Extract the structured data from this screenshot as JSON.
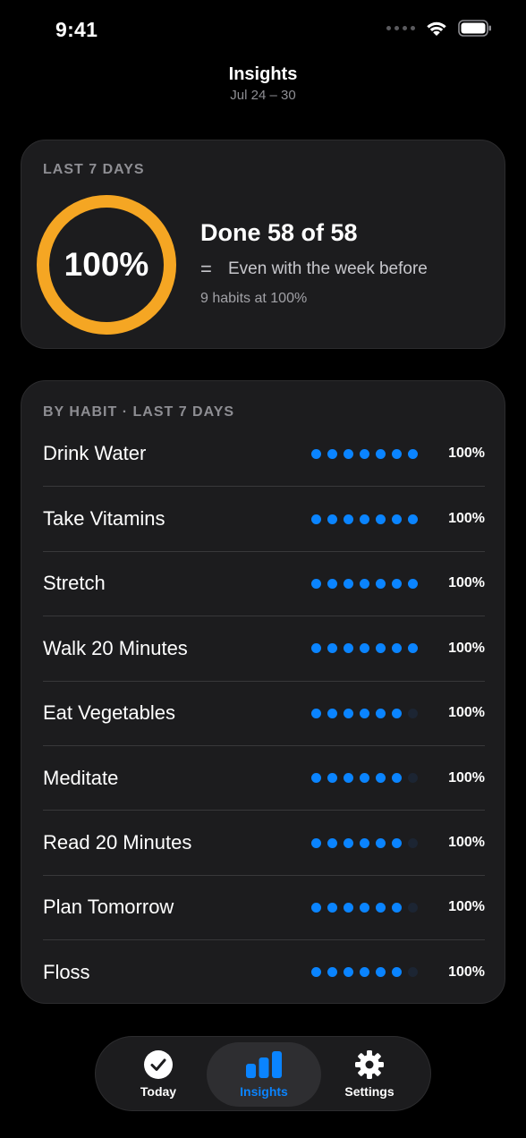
{
  "status_bar": {
    "time": "9:41"
  },
  "header": {
    "title": "Insights",
    "date_range": "Jul 24 – 30"
  },
  "summary": {
    "section_label": "LAST 7 DAYS",
    "percent": "100%",
    "completion_fraction": 1.0,
    "done_text": "Done 58 of 58",
    "comparison": "Even with the week before",
    "habits_at_full": "9 habits at 100%"
  },
  "habits_section": {
    "label": "BY HABIT · LAST 7 DAYS",
    "items": [
      {
        "name": "Drink Water",
        "percent": "100%",
        "days": [
          1,
          1,
          1,
          1,
          1,
          1,
          1
        ]
      },
      {
        "name": "Take Vitamins",
        "percent": "100%",
        "days": [
          1,
          1,
          1,
          1,
          1,
          1,
          1
        ]
      },
      {
        "name": "Stretch",
        "percent": "100%",
        "days": [
          1,
          1,
          1,
          1,
          1,
          1,
          1
        ]
      },
      {
        "name": "Walk 20 Minutes",
        "percent": "100%",
        "days": [
          1,
          1,
          1,
          1,
          1,
          1,
          1
        ]
      },
      {
        "name": "Eat Vegetables",
        "percent": "100%",
        "days": [
          1,
          1,
          1,
          1,
          1,
          1,
          0
        ]
      },
      {
        "name": "Meditate",
        "percent": "100%",
        "days": [
          1,
          1,
          1,
          1,
          1,
          1,
          0
        ]
      },
      {
        "name": "Read 20 Minutes",
        "percent": "100%",
        "days": [
          1,
          1,
          1,
          1,
          1,
          1,
          0
        ]
      },
      {
        "name": "Plan Tomorrow",
        "percent": "100%",
        "days": [
          1,
          1,
          1,
          1,
          1,
          1,
          0
        ]
      },
      {
        "name": "Floss",
        "percent": "100%",
        "days": [
          1,
          1,
          1,
          1,
          1,
          1,
          0
        ]
      }
    ]
  },
  "tab_bar": {
    "tabs": [
      {
        "label": "Today",
        "icon": "checkmark-circle-icon",
        "active": false
      },
      {
        "label": "Insights",
        "icon": "bar-chart-icon",
        "active": true
      },
      {
        "label": "Settings",
        "icon": "gear-icon",
        "active": false
      }
    ]
  },
  "colors": {
    "accent": "#0a84ff",
    "ring": "#f5a623",
    "dot_off": "#1c2533",
    "card": "#1c1c1e"
  }
}
